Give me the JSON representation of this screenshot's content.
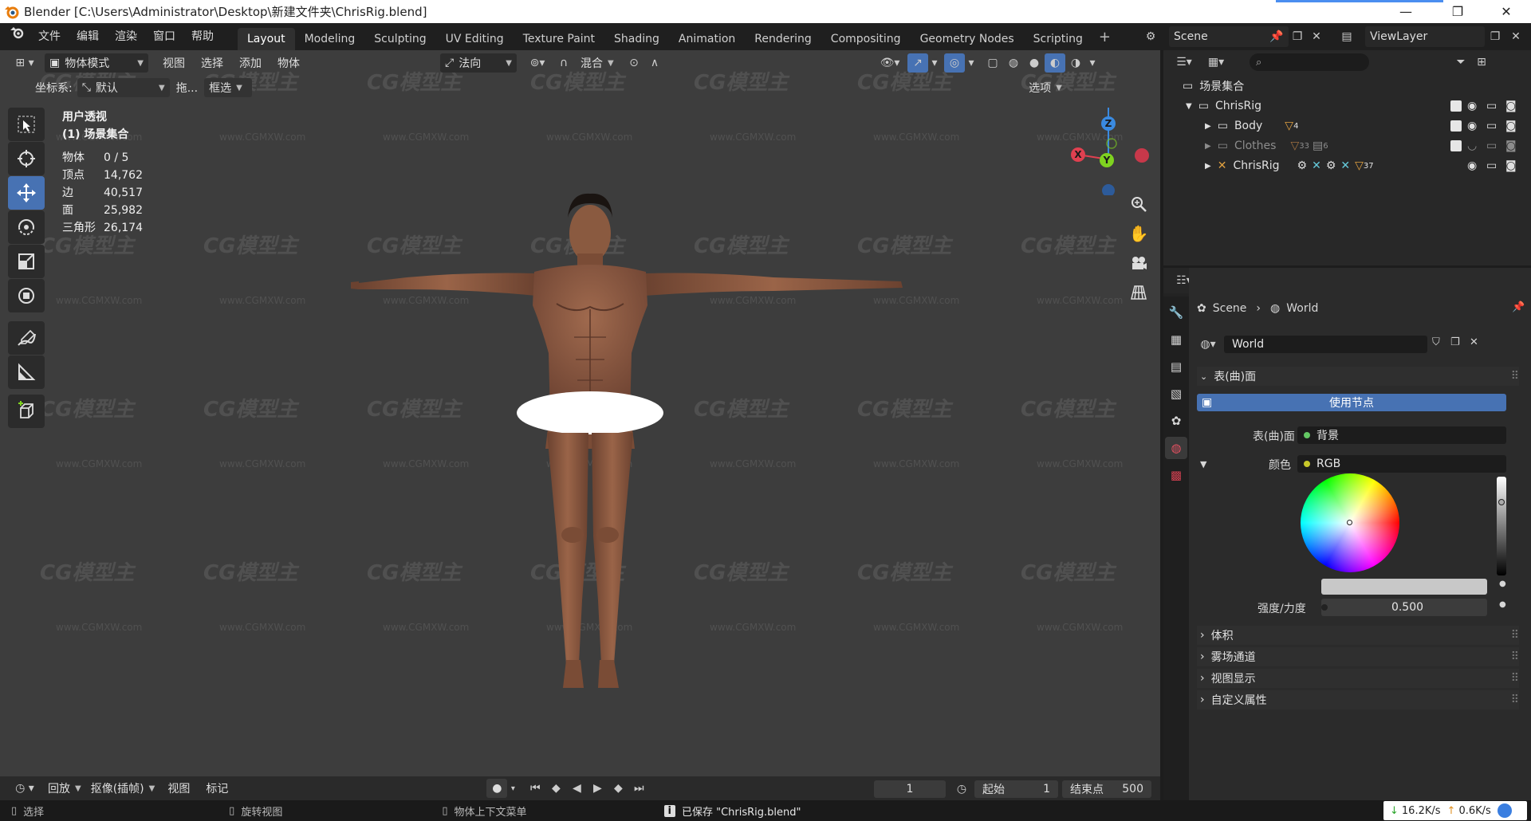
{
  "window": {
    "title": "Blender [C:\\Users\\Administrator\\Desktop\\新建文件夹\\ChrisRig.blend]"
  },
  "menu": [
    "文件",
    "编辑",
    "渲染",
    "窗口",
    "帮助"
  ],
  "workspaces": [
    "Layout",
    "Modeling",
    "Sculpting",
    "UV Editing",
    "Texture Paint",
    "Shading",
    "Animation",
    "Rendering",
    "Compositing",
    "Geometry Nodes",
    "Scripting"
  ],
  "active_workspace": "Layout",
  "scene": {
    "name": "Scene",
    "view_layer": "ViewLayer"
  },
  "viewport_header": {
    "mode": "物体模式",
    "menus": [
      "视图",
      "选择",
      "添加",
      "物体"
    ],
    "orientation": "法向",
    "pivot": "混合",
    "options": "选项"
  },
  "viewport_header2": {
    "coord_label": "坐标系:",
    "coord_value": "默认",
    "drag_label": "拖...",
    "drag_value": "框选"
  },
  "viewport_info": {
    "view_name": "用户透视",
    "collection": "(1) 场景集合",
    "stats": [
      {
        "label": "物体",
        "value": "0 / 5"
      },
      {
        "label": "顶点",
        "value": "14,762"
      },
      {
        "label": "边",
        "value": "40,517"
      },
      {
        "label": "面",
        "value": "25,982"
      },
      {
        "label": "三角形",
        "value": "26,174"
      }
    ]
  },
  "gizmo": {
    "x": "X",
    "y": "Y",
    "z": "Z"
  },
  "watermark": {
    "text": "CG模型主",
    "url": "www.CGMXW.com"
  },
  "outliner": {
    "root": "场景集合",
    "items": [
      {
        "name": "ChrisRig",
        "badge": ""
      },
      {
        "name": "Body",
        "badge": "4"
      },
      {
        "name": "Clothes",
        "badge": "33",
        "badge2": "6"
      },
      {
        "name": "ChrisRig",
        "badge": "37"
      }
    ]
  },
  "properties": {
    "breadcrumb": [
      "Scene",
      "World"
    ],
    "world_name": "World",
    "surface_panel": "表(曲)面",
    "use_nodes": "使用节点",
    "surface_label": "表(曲)面",
    "surface_value": "背景",
    "color_label": "颜色",
    "color_value": "RGB",
    "strength_label": "强度/力度",
    "strength_value": "0.500",
    "panels": [
      "体积",
      "雾场通道",
      "视图显示",
      "自定义属性"
    ]
  },
  "timeline": {
    "menus": [
      "回放",
      "抠像(插帧)",
      "视图",
      "标记"
    ],
    "current_frame": "1",
    "start_label": "起始",
    "start_value": "1",
    "end_label": "结束点",
    "end_value": "500"
  },
  "statusbar": {
    "select": "选择",
    "rotate": "旋转视图",
    "context": "物体上下文菜单",
    "saved": "已保存 \"ChrisRig.blend\"",
    "down_speed": "16.2K/s",
    "up_speed": "0.6K/s"
  },
  "colors": {
    "accent": "#4772b3",
    "viewport_bg": "#3d3d3d",
    "axis_x": "#e04050",
    "axis_y": "#7fd320",
    "axis_z": "#3a8ae0"
  }
}
